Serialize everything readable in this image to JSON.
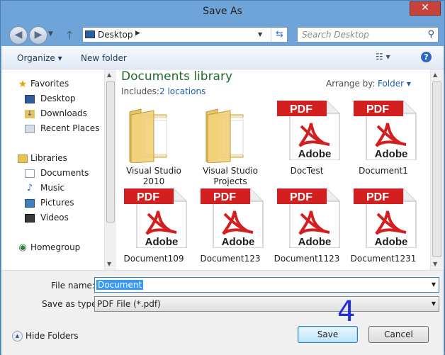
{
  "window": {
    "title": "Save As",
    "close_glyph": "✕"
  },
  "address": {
    "back_glyph": "◀",
    "forward_glyph": "▶",
    "up_glyph": "🡑",
    "location": "Desktop",
    "search_placeholder": "Search Desktop"
  },
  "toolbar": {
    "organize_label": "Organize ▾",
    "new_folder_label": "New folder",
    "view_glyph": "☷ ▾",
    "help_glyph": "?"
  },
  "nav": {
    "favorites_header": "Favorites",
    "favorites": [
      "Desktop",
      "Downloads",
      "Recent Places"
    ],
    "libraries_header": "Libraries",
    "libraries": [
      "Documents",
      "Music",
      "Pictures",
      "Videos"
    ],
    "homegroup": "Homegroup"
  },
  "library": {
    "title": "Documents library",
    "includes_label": "Includes:",
    "locations_link": "2 locations",
    "arrange_label": "Arrange by:",
    "arrange_value": "Folder ▾"
  },
  "files": [
    {
      "name": "Visual Studio\n2010",
      "kind": "folder"
    },
    {
      "name": "Visual Studio\nProjects",
      "kind": "folder"
    },
    {
      "name": "DocTest",
      "kind": "pdf"
    },
    {
      "name": "Document1",
      "kind": "pdf"
    },
    {
      "name": "Document109",
      "kind": "pdf"
    },
    {
      "name": "Document123",
      "kind": "pdf"
    },
    {
      "name": "Document1123",
      "kind": "pdf"
    },
    {
      "name": "Document1231",
      "kind": "pdf"
    }
  ],
  "pdf_badge": "PDF",
  "pdf_brand": "Adobe",
  "form": {
    "file_name_label": "File name:",
    "file_name_value": "Document",
    "save_type_label": "Save as type:",
    "save_type_value": "PDF File (*.pdf)",
    "hide_folders": "Hide Folders",
    "save_button": "Save",
    "cancel_button": "Cancel"
  },
  "annotation": "4",
  "colors": {
    "accent": "#3399ff",
    "title_green": "#1e6b2a",
    "link_blue": "#1a5fb4",
    "pdf_red": "#d31f1f",
    "annotation_blue": "#2030d8"
  }
}
